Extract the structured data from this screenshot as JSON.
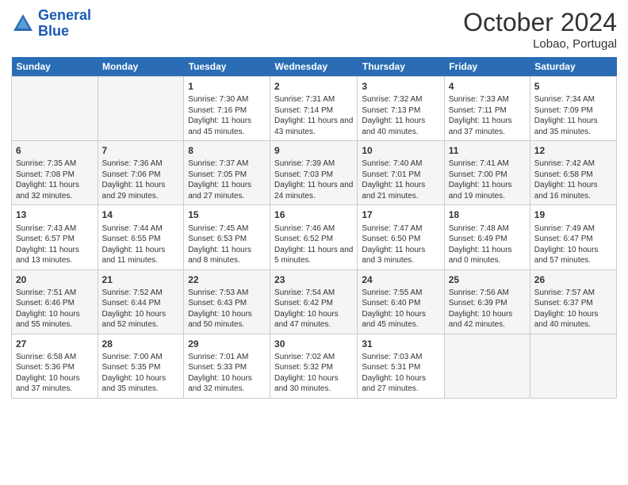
{
  "header": {
    "logo_line1": "General",
    "logo_line2": "Blue",
    "month": "October 2024",
    "location": "Lobao, Portugal"
  },
  "weekdays": [
    "Sunday",
    "Monday",
    "Tuesday",
    "Wednesday",
    "Thursday",
    "Friday",
    "Saturday"
  ],
  "weeks": [
    [
      {
        "day": "",
        "info": ""
      },
      {
        "day": "",
        "info": ""
      },
      {
        "day": "1",
        "info": "Sunrise: 7:30 AM\nSunset: 7:16 PM\nDaylight: 11 hours and 45 minutes."
      },
      {
        "day": "2",
        "info": "Sunrise: 7:31 AM\nSunset: 7:14 PM\nDaylight: 11 hours and 43 minutes."
      },
      {
        "day": "3",
        "info": "Sunrise: 7:32 AM\nSunset: 7:13 PM\nDaylight: 11 hours and 40 minutes."
      },
      {
        "day": "4",
        "info": "Sunrise: 7:33 AM\nSunset: 7:11 PM\nDaylight: 11 hours and 37 minutes."
      },
      {
        "day": "5",
        "info": "Sunrise: 7:34 AM\nSunset: 7:09 PM\nDaylight: 11 hours and 35 minutes."
      }
    ],
    [
      {
        "day": "6",
        "info": "Sunrise: 7:35 AM\nSunset: 7:08 PM\nDaylight: 11 hours and 32 minutes."
      },
      {
        "day": "7",
        "info": "Sunrise: 7:36 AM\nSunset: 7:06 PM\nDaylight: 11 hours and 29 minutes."
      },
      {
        "day": "8",
        "info": "Sunrise: 7:37 AM\nSunset: 7:05 PM\nDaylight: 11 hours and 27 minutes."
      },
      {
        "day": "9",
        "info": "Sunrise: 7:39 AM\nSunset: 7:03 PM\nDaylight: 11 hours and 24 minutes."
      },
      {
        "day": "10",
        "info": "Sunrise: 7:40 AM\nSunset: 7:01 PM\nDaylight: 11 hours and 21 minutes."
      },
      {
        "day": "11",
        "info": "Sunrise: 7:41 AM\nSunset: 7:00 PM\nDaylight: 11 hours and 19 minutes."
      },
      {
        "day": "12",
        "info": "Sunrise: 7:42 AM\nSunset: 6:58 PM\nDaylight: 11 hours and 16 minutes."
      }
    ],
    [
      {
        "day": "13",
        "info": "Sunrise: 7:43 AM\nSunset: 6:57 PM\nDaylight: 11 hours and 13 minutes."
      },
      {
        "day": "14",
        "info": "Sunrise: 7:44 AM\nSunset: 6:55 PM\nDaylight: 11 hours and 11 minutes."
      },
      {
        "day": "15",
        "info": "Sunrise: 7:45 AM\nSunset: 6:53 PM\nDaylight: 11 hours and 8 minutes."
      },
      {
        "day": "16",
        "info": "Sunrise: 7:46 AM\nSunset: 6:52 PM\nDaylight: 11 hours and 5 minutes."
      },
      {
        "day": "17",
        "info": "Sunrise: 7:47 AM\nSunset: 6:50 PM\nDaylight: 11 hours and 3 minutes."
      },
      {
        "day": "18",
        "info": "Sunrise: 7:48 AM\nSunset: 6:49 PM\nDaylight: 11 hours and 0 minutes."
      },
      {
        "day": "19",
        "info": "Sunrise: 7:49 AM\nSunset: 6:47 PM\nDaylight: 10 hours and 57 minutes."
      }
    ],
    [
      {
        "day": "20",
        "info": "Sunrise: 7:51 AM\nSunset: 6:46 PM\nDaylight: 10 hours and 55 minutes."
      },
      {
        "day": "21",
        "info": "Sunrise: 7:52 AM\nSunset: 6:44 PM\nDaylight: 10 hours and 52 minutes."
      },
      {
        "day": "22",
        "info": "Sunrise: 7:53 AM\nSunset: 6:43 PM\nDaylight: 10 hours and 50 minutes."
      },
      {
        "day": "23",
        "info": "Sunrise: 7:54 AM\nSunset: 6:42 PM\nDaylight: 10 hours and 47 minutes."
      },
      {
        "day": "24",
        "info": "Sunrise: 7:55 AM\nSunset: 6:40 PM\nDaylight: 10 hours and 45 minutes."
      },
      {
        "day": "25",
        "info": "Sunrise: 7:56 AM\nSunset: 6:39 PM\nDaylight: 10 hours and 42 minutes."
      },
      {
        "day": "26",
        "info": "Sunrise: 7:57 AM\nSunset: 6:37 PM\nDaylight: 10 hours and 40 minutes."
      }
    ],
    [
      {
        "day": "27",
        "info": "Sunrise: 6:58 AM\nSunset: 5:36 PM\nDaylight: 10 hours and 37 minutes."
      },
      {
        "day": "28",
        "info": "Sunrise: 7:00 AM\nSunset: 5:35 PM\nDaylight: 10 hours and 35 minutes."
      },
      {
        "day": "29",
        "info": "Sunrise: 7:01 AM\nSunset: 5:33 PM\nDaylight: 10 hours and 32 minutes."
      },
      {
        "day": "30",
        "info": "Sunrise: 7:02 AM\nSunset: 5:32 PM\nDaylight: 10 hours and 30 minutes."
      },
      {
        "day": "31",
        "info": "Sunrise: 7:03 AM\nSunset: 5:31 PM\nDaylight: 10 hours and 27 minutes."
      },
      {
        "day": "",
        "info": ""
      },
      {
        "day": "",
        "info": ""
      }
    ]
  ]
}
